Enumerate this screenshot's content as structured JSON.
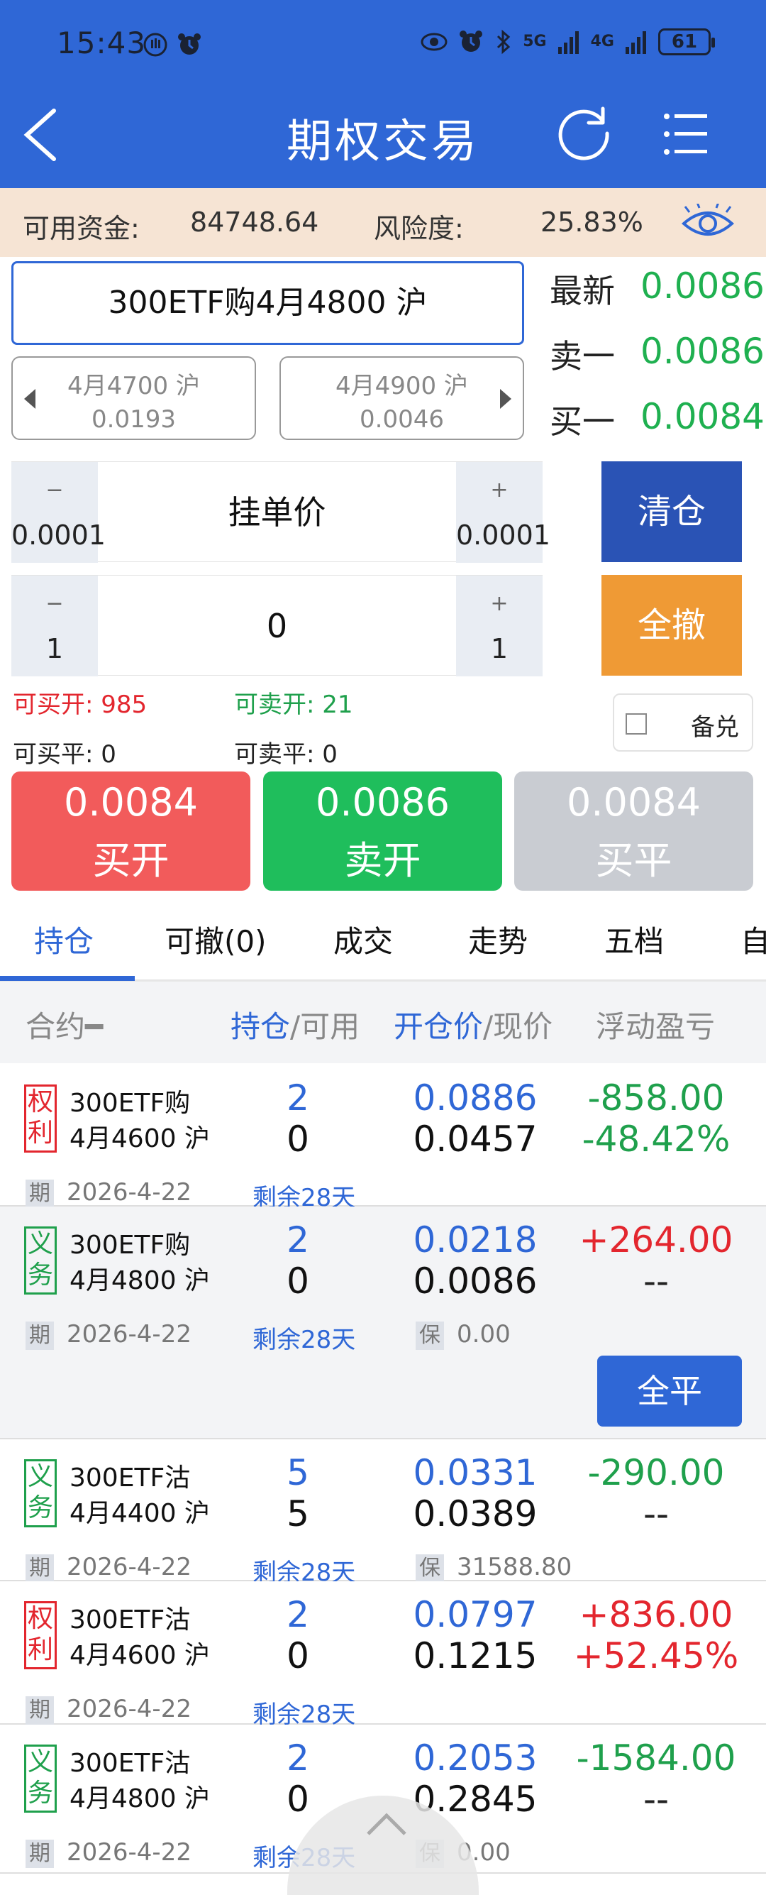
{
  "status": {
    "time": "15:43",
    "battery": "61",
    "net1": "5G",
    "net2": "4G"
  },
  "header": {
    "title": "期权交易"
  },
  "funds": {
    "available_label": "可用资金:",
    "available_value": "84748.64",
    "risk_label": "风险度:",
    "risk_value": "25.83%"
  },
  "contract": {
    "name": "300ETF购4月4800 沪",
    "prev": {
      "name": "4月4700 沪",
      "price": "0.0193"
    },
    "next": {
      "name": "4月4900 沪",
      "price": "0.0046"
    }
  },
  "quotes": [
    {
      "label": "最新",
      "value": "0.0086"
    },
    {
      "label": "卖一",
      "value": "0.0086"
    },
    {
      "label": "买一",
      "value": "0.0084"
    }
  ],
  "price_stepper": {
    "minus_sym": "−",
    "minus_val": "0.0001",
    "label": "挂单价",
    "plus_sym": "+",
    "plus_val": "0.0001"
  },
  "qty_stepper": {
    "minus_sym": "−",
    "minus_val": "1",
    "value": "0",
    "plus_sym": "+",
    "plus_val": "1"
  },
  "actions": {
    "close_all": "清仓",
    "cancel_all": "全撤",
    "covered": "备兑"
  },
  "availability": {
    "buy_open": "可买开: 985",
    "sell_open": "可卖开: 21",
    "buy_close": "可买平: 0",
    "sell_close": "可卖平: 0"
  },
  "order_buttons": [
    {
      "price": "0.0084",
      "action": "买开",
      "color": "#f25b5b"
    },
    {
      "price": "0.0086",
      "action": "卖开",
      "color": "#1fbe5c"
    },
    {
      "price": "0.0084",
      "action": "买平",
      "color": "#c9ccd2"
    }
  ],
  "tabs": [
    "持仓",
    "可撤(0)",
    "成交",
    "走势",
    "五档",
    "自"
  ],
  "table_header": {
    "contract": "合约━",
    "pos": "持仓",
    "pos2": "/可用",
    "open": "开仓价",
    "open2": "/现价",
    "pnl": "浮动盈亏"
  },
  "positions": [
    {
      "tag1": "权",
      "tag2": "利",
      "type": "quan",
      "line1": "300ETF购",
      "line2": "4月4600 沪",
      "hold": "2",
      "avail": "0",
      "open_price": "0.0886",
      "cur_price": "0.0457",
      "pnl": "-858.00",
      "pnl_pct": "-48.42%",
      "pnl_color": "#1fa04c",
      "pct_color": "#1fa04c",
      "date_tag": "期",
      "date": "2026-4-22",
      "remain": "剩余28天",
      "margin_tag": "",
      "margin": ""
    },
    {
      "tag1": "义",
      "tag2": "务",
      "type": "yi",
      "line1": "300ETF购",
      "line2": "4月4800 沪",
      "hold": "2",
      "avail": "0",
      "open_price": "0.0218",
      "cur_price": "0.0086",
      "pnl": "+264.00",
      "pnl_pct": "--",
      "pnl_color": "#e3262e",
      "pct_color": "#222222",
      "date_tag": "期",
      "date": "2026-4-22",
      "remain": "剩余28天",
      "margin_tag": "保",
      "margin": "0.00",
      "close_label": "全平"
    },
    {
      "tag1": "义",
      "tag2": "务",
      "type": "yi",
      "line1": "300ETF沽",
      "line2": "4月4400 沪",
      "hold": "5",
      "avail": "5",
      "open_price": "0.0331",
      "cur_price": "0.0389",
      "pnl": "-290.00",
      "pnl_pct": "--",
      "pnl_color": "#1fa04c",
      "pct_color": "#222222",
      "date_tag": "期",
      "date": "2026-4-22",
      "remain": "剩余28天",
      "margin_tag": "保",
      "margin": "31588.80"
    },
    {
      "tag1": "权",
      "tag2": "利",
      "type": "quan",
      "line1": "300ETF沽",
      "line2": "4月4600 沪",
      "hold": "2",
      "avail": "0",
      "open_price": "0.0797",
      "cur_price": "0.1215",
      "pnl": "+836.00",
      "pnl_pct": "+52.45%",
      "pnl_color": "#e3262e",
      "pct_color": "#e3262e",
      "date_tag": "期",
      "date": "2026-4-22",
      "remain": "剩余28天",
      "margin_tag": "",
      "margin": ""
    },
    {
      "tag1": "义",
      "tag2": "务",
      "type": "yi",
      "line1": "300ETF沽",
      "line2": "4月4800 沪",
      "hold": "2",
      "avail": "0",
      "open_price": "0.2053",
      "cur_price": "0.2845",
      "pnl": "-1584.00",
      "pnl_pct": "--",
      "pnl_color": "#1fa04c",
      "pct_color": "#222222",
      "date_tag": "期",
      "date": "2026-4-22",
      "remain": "剩余28天",
      "margin_tag": "保",
      "margin": "0.00"
    }
  ]
}
